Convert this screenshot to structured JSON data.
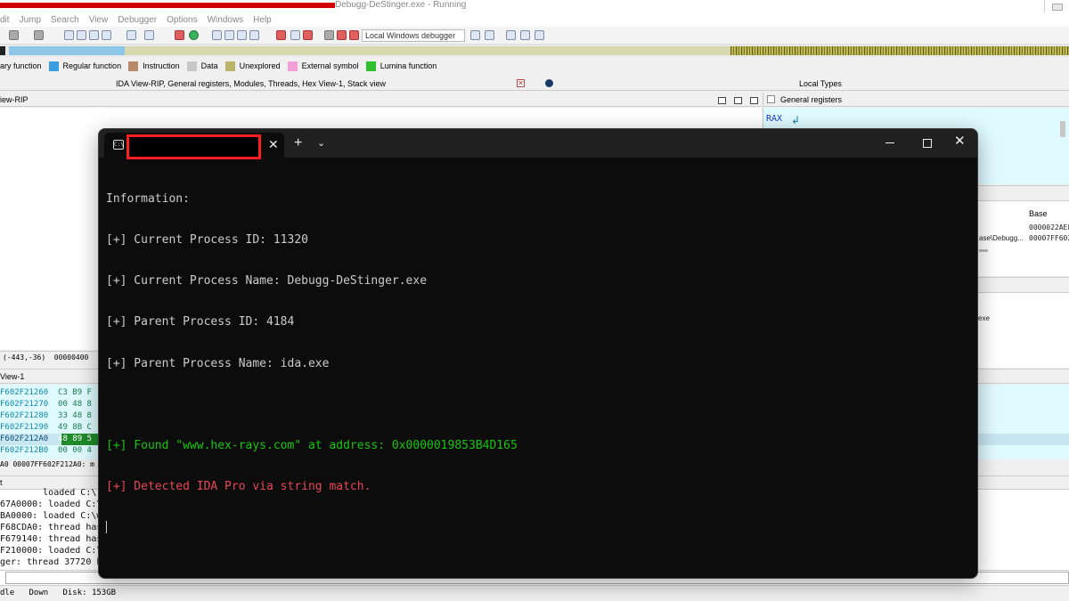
{
  "ida": {
    "title_text": "Debugg-DeStinger.exe - Running",
    "menu": [
      "dit",
      "Jump",
      "Search",
      "View",
      "Debugger",
      "Options",
      "Windows",
      "Help"
    ],
    "debugger_select": "Local Windows debugger",
    "legend": [
      {
        "label": "ary function",
        "color": ""
      },
      {
        "label": "Regular function",
        "color": "#3a9de0"
      },
      {
        "label": "Instruction",
        "color": "#b98a6a"
      },
      {
        "label": "Data",
        "color": "#c8c8c8"
      },
      {
        "label": "Unexplored",
        "color": "#b8b46a"
      },
      {
        "label": "External symbol",
        "color": "#f4a0d8"
      },
      {
        "label": "Lumina function",
        "color": "#2fc02f"
      }
    ],
    "tabs_label": "IDA View-RIP, General registers, Modules, Threads, Hex View-1, Stack view",
    "tabs_close": "✕",
    "local_types_label": "Local Types",
    "ida_view_title": "iew-RIP",
    "ida_view_status": "(-443,-36)  00000400",
    "general_registers_title": "General registers",
    "reg_rax": "RAX",
    "reg_rax_icon": "↲",
    "modules": {
      "col_base": "Base",
      "row1_base": "0000022AE8",
      "row2_path": "ase\\Debugg...",
      "row2_base": "00007FF602"
    },
    "threads_text": "exe",
    "hex_title": "View-1",
    "hex_rows": [
      {
        "addr": "F602F21260",
        "bytes": "C3 B9 F"
      },
      {
        "addr": "F602F21270",
        "bytes": "00 48 8"
      },
      {
        "addr": "F602F21280",
        "bytes": "33 48 8"
      },
      {
        "addr": "F602F21290",
        "bytes": "49 8B C"
      },
      {
        "addr": "F602F212A0",
        "bytes": "48 89 5"
      },
      {
        "addr": "F602F212B0",
        "bytes": "00 00 4"
      }
    ],
    "hex_status": "A0 00007FF602F212A0: m",
    "output_title": "t",
    "output_lines": [
      "        loaded C:\\",
      "67A0000: loaded C:\\",
      "BA0000: loaded C:\\w",
      "F68CDA0: thread has",
      "F679140: thread has",
      "F210000: loaded C:\\",
      "ger: thread 37720 h"
    ],
    "statusbar": "dle   Down   Disk: 153GB"
  },
  "terminal": {
    "tab_icon": "C:\\",
    "tab_close": "✕",
    "new_tab": "+",
    "dropdown": "⌄",
    "close": "✕",
    "lines": [
      {
        "text": "Information:",
        "style": "default"
      },
      {
        "text": "[+] Current Process ID: 11320",
        "style": "default"
      },
      {
        "text": "[+] Current Process Name: Debugg-DeStinger.exe",
        "style": "default"
      },
      {
        "text": "[+] Parent Process ID: 4184",
        "style": "default"
      },
      {
        "text": "[+] Parent Process Name: ida.exe",
        "style": "default"
      },
      {
        "text": "",
        "style": "default"
      },
      {
        "text": "[+] Found \"www.hex-rays.com\" at address: 0x0000019853B4D165",
        "style": "green"
      },
      {
        "text": "[+] Detected IDA Pro via string match.",
        "style": "red"
      }
    ]
  }
}
